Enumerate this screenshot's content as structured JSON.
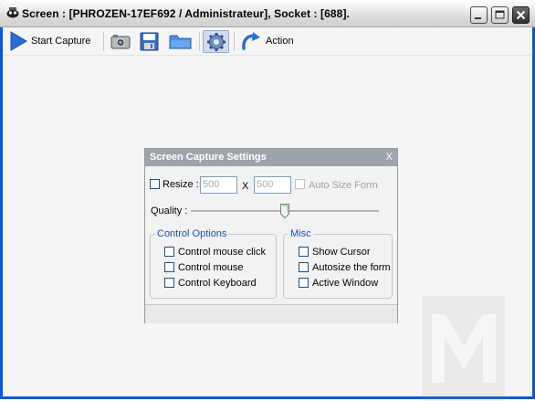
{
  "window": {
    "title": "Screen : [PHROZEN-17EF692 / Administrateur], Socket : [688].",
    "controls": [
      "minimize",
      "maximize",
      "close"
    ]
  },
  "toolbar": {
    "start_capture_label": "Start Capture",
    "action_label": "Action",
    "icons": [
      "play-icon",
      "camera-icon",
      "floppy-disk-icon",
      "folder-icon",
      "gear-icon",
      "refresh-arrow-icon"
    ]
  },
  "dialog": {
    "title": "Screen Capture Settings",
    "close_label": "X",
    "resize_label": "Resize :",
    "width_value": "500",
    "x_label": "X",
    "height_value": "500",
    "auto_size_label": "Auto Size Form",
    "quality_label": "Quality :",
    "quality_level": 0.5,
    "control_options": {
      "legend": "Control Options",
      "items": [
        "Control mouse click",
        "Control mouse",
        "Control Keyboard"
      ]
    },
    "misc": {
      "legend": "Misc",
      "items": [
        "Show Cursor",
        "Autosize the form",
        "Active Window"
      ]
    }
  },
  "colors": {
    "window_frame": "#0a57d8",
    "dialog_title_bar": "#9ea4ab",
    "group_legend": "#1c4fa8",
    "toolbar_icon_blue": "#2a6fd6"
  }
}
